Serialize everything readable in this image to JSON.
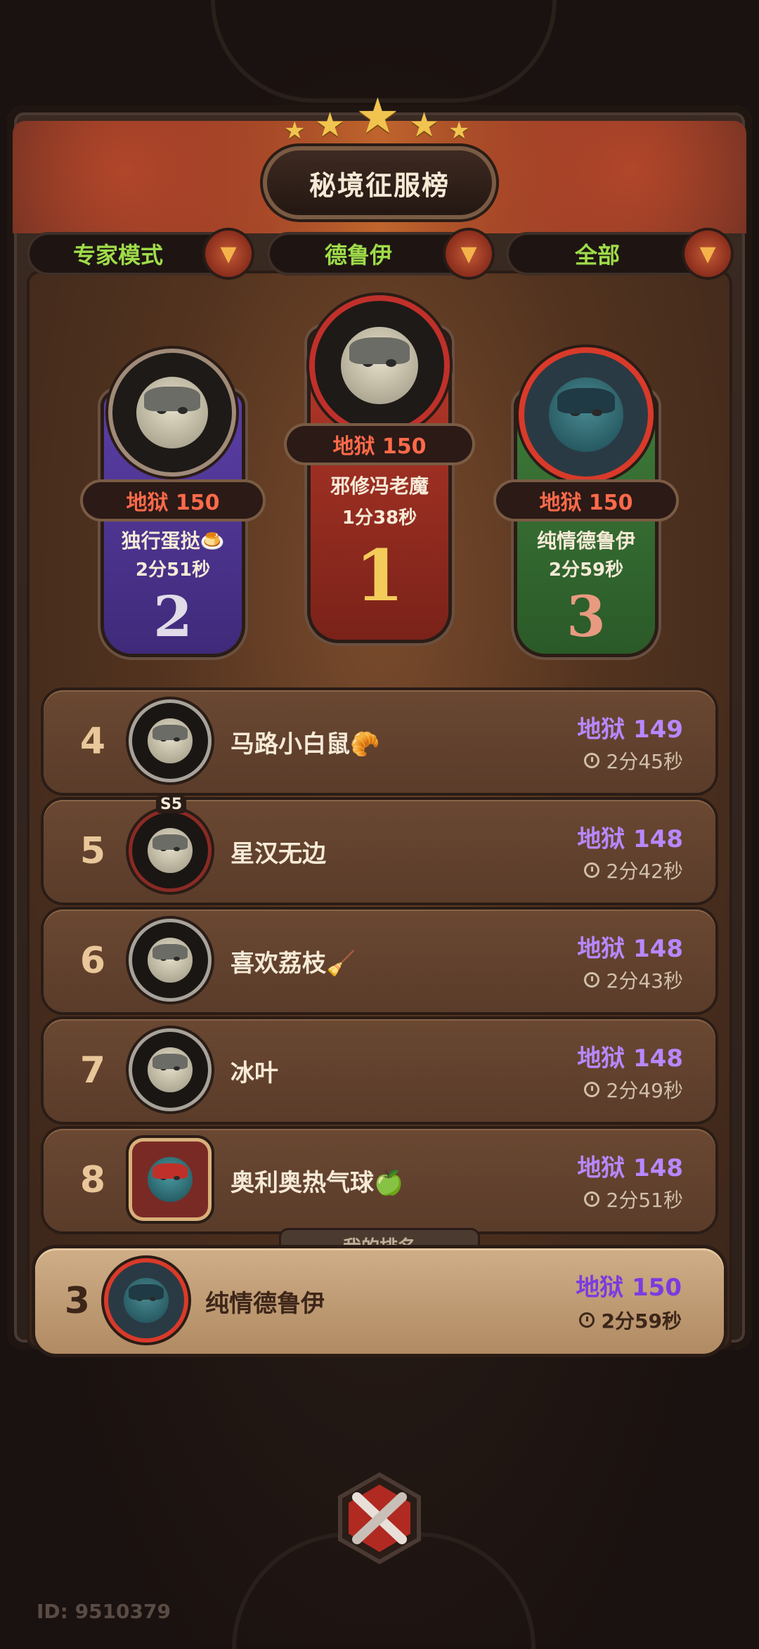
{
  "header": {
    "title": "秘境征服榜"
  },
  "filters": [
    {
      "label": "专家模式"
    },
    {
      "label": "德鲁伊"
    },
    {
      "label": "全部"
    }
  ],
  "podium": {
    "first": {
      "rank": "1",
      "level": "地狱 150",
      "name": "邪修冯老魔",
      "time": "1分38秒"
    },
    "second": {
      "rank": "2",
      "level": "地狱 150",
      "name": "独行蛋挞🍮",
      "time": "2分51秒"
    },
    "third": {
      "rank": "3",
      "level": "地狱 150",
      "name": "纯情德鲁伊",
      "time": "2分59秒"
    }
  },
  "rows": [
    {
      "rank": "4",
      "name": "马路小白鼠🥐",
      "level": "地狱 149",
      "time": "2分45秒"
    },
    {
      "rank": "5",
      "name": "星汉无边",
      "level": "地狱 148",
      "time": "2分42秒",
      "badge": "S5"
    },
    {
      "rank": "6",
      "name": "喜欢荔枝🧹",
      "level": "地狱 148",
      "time": "2分43秒"
    },
    {
      "rank": "7",
      "name": "冰叶",
      "level": "地狱 148",
      "time": "2分49秒"
    },
    {
      "rank": "8",
      "name": "奥利奥热气球🍏",
      "level": "地狱 148",
      "time": "2分51秒"
    }
  ],
  "my_rank": {
    "label": "我的排名",
    "rank": "3",
    "name": "纯情德鲁伊",
    "level": "地狱 150",
    "time": "2分59秒"
  },
  "footer": {
    "player_id": "ID: 9510379"
  },
  "colors": {
    "accent_green": "#9fdc4a",
    "hell_red": "#ff6a4a",
    "hell_purple": "#b788ff",
    "gold": "#f0c44f"
  }
}
